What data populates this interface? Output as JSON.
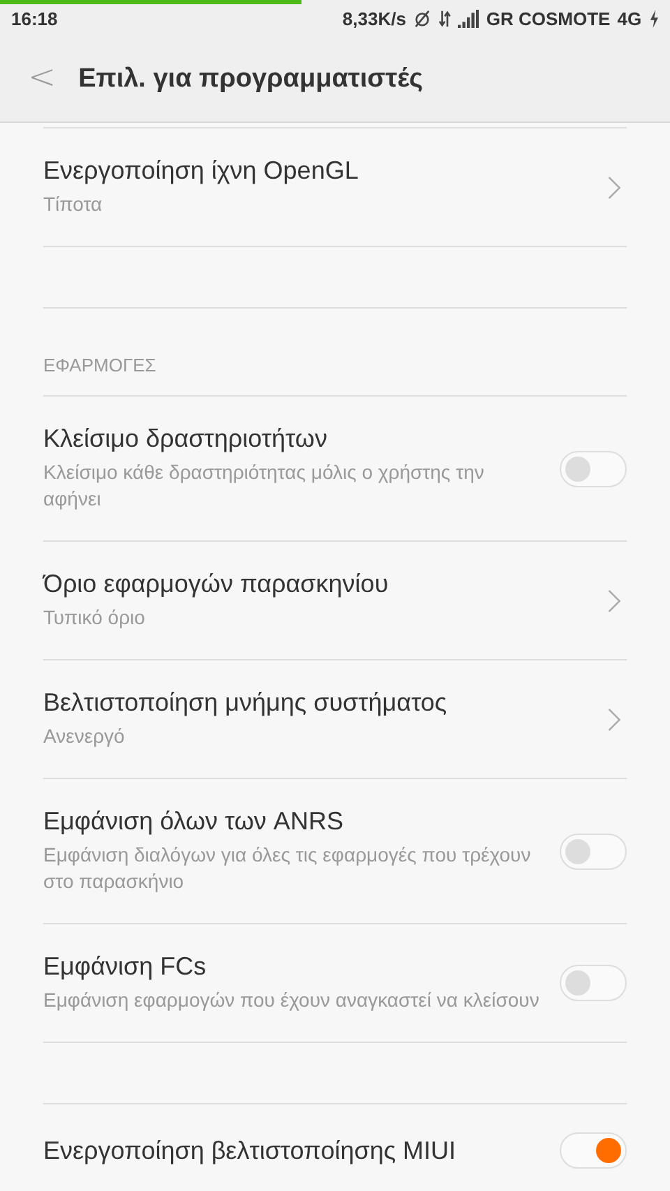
{
  "status_bar": {
    "time": "16:18",
    "speed": "8,33K/s",
    "carrier": "GR COSMOTE",
    "network": "4G",
    "progress": {
      "level": 0.45
    }
  },
  "header": {
    "back": "<",
    "title": "Επιλ. για προγραμματιστές"
  },
  "sections": [
    {
      "items": [
        {
          "kind": "chevron",
          "title": "Ενεργοποίηση ίχνη OpenGL",
          "subtitle": "Τίποτα"
        }
      ]
    },
    {
      "heading": "ΕΦΑΡΜΟΓΕΣ",
      "items": [
        {
          "kind": "toggle",
          "title": "Κλείσιμο δραστηριοτήτων",
          "subtitle": "Κλείσιμο κάθε δραστηριότητας μόλις ο χρήστης την αφήνει",
          "on": false
        },
        {
          "kind": "chevron",
          "title": "Όριο εφαρμογών παρασκηνίου",
          "subtitle": "Τυπικό όριο"
        },
        {
          "kind": "chevron",
          "title": "Βελτιστοποίηση μνήμης συστήματος",
          "subtitle": "Ανενεργό"
        },
        {
          "kind": "toggle",
          "title": "Εμφάνιση όλων των ANRS",
          "subtitle": "Εμφάνιση διαλόγων για όλες τις εφαρμογές που τρέχουν στο παρασκήνιο",
          "on": false
        },
        {
          "kind": "toggle",
          "title": "Εμφάνιση FCs",
          "subtitle": "Εμφάνιση εφαρμογών που έχουν αναγκαστεί να κλείσουν",
          "on": false
        }
      ]
    },
    {
      "items": [
        {
          "kind": "toggle",
          "title": "Ενεργοποίηση βελτιστοποίησης MIUI",
          "on": true
        }
      ]
    }
  ]
}
